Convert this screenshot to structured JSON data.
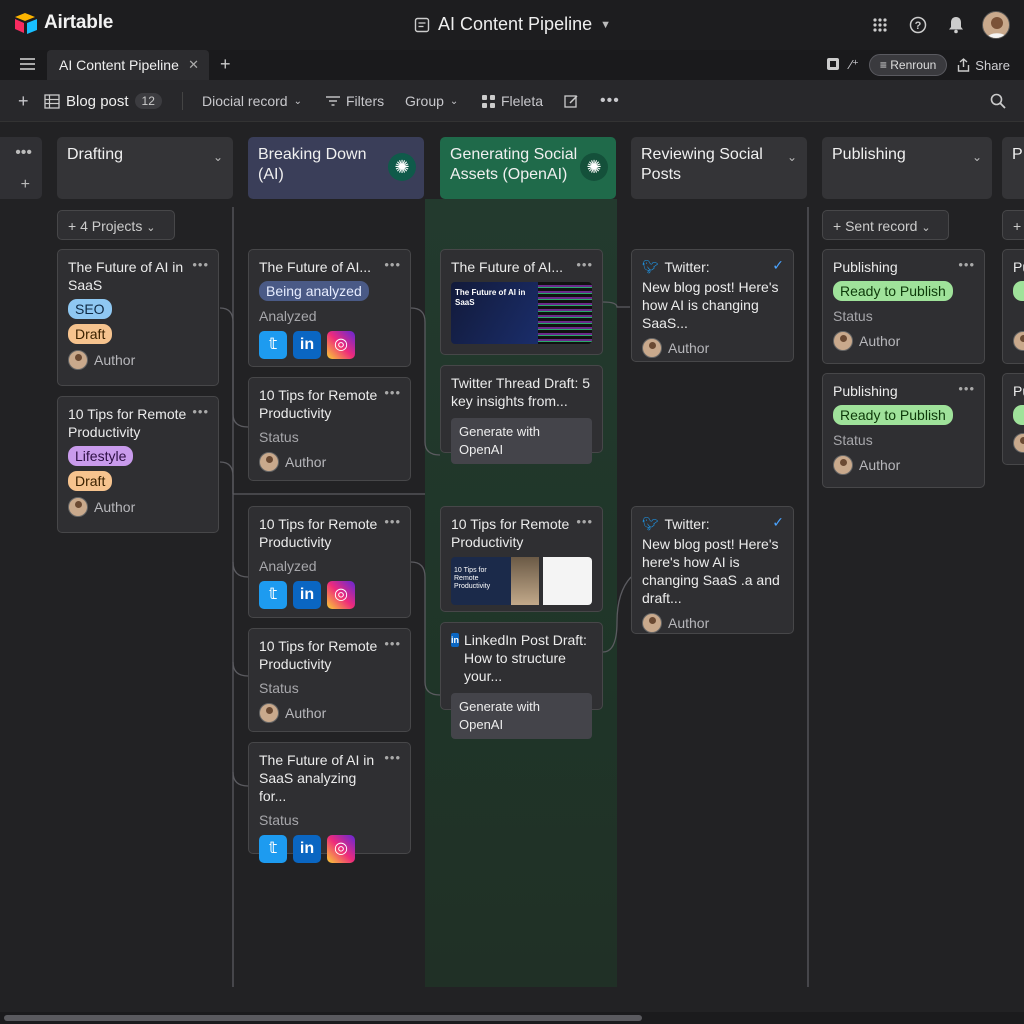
{
  "app": {
    "name": "Airtable",
    "base_title": "AI Content Pipeline"
  },
  "tabbar": {
    "tab_label": "AI Content Pipeline",
    "extensions_label": "Renroun",
    "share_label": "Share"
  },
  "toolbar": {
    "table_name": "Blog post",
    "record_count": "12",
    "view_label": "Diocial record",
    "filters_label": "Filters",
    "group_label": "Group",
    "fields_label": "Fleleta"
  },
  "columns": [
    {
      "title": "Drafting",
      "add_label": "4 Projects"
    },
    {
      "title": "Breaking Down (AI)"
    },
    {
      "title": "Generating Social Assets (OpenAI)"
    },
    {
      "title": "Reviewing Social Posts"
    },
    {
      "title": "Publishing",
      "add_label": "Sent record"
    },
    {
      "title": "P"
    }
  ],
  "drafting": [
    {
      "title": "The Future of AI in SaaS",
      "tag1": "SEO",
      "tag2": "Draft",
      "author": "Author"
    },
    {
      "title": "10 Tips for Remote Productivity",
      "tag1": "Lifestyle",
      "tag2": "Draft",
      "author": "Author"
    }
  ],
  "breaking": [
    {
      "title": "The Future of AI...",
      "tag": "Being analyzed",
      "status": "Analyzed"
    },
    {
      "title": "10 Tips for Remote Productivity",
      "status": "Status",
      "author": "Author"
    },
    {
      "title": "10 Tips for Remote Productivity",
      "status": "Analyzed"
    },
    {
      "title": "10 Tips for Remote Productivity",
      "status": "Status",
      "author": "Author"
    },
    {
      "title": "The Future of AI in SaaS analyzing for...",
      "status": "Status"
    }
  ],
  "generating": [
    {
      "title": "The Future of AI...",
      "thumb_text": "The Future of AI in SaaS"
    },
    {
      "title": "Twitter Thread Draft: 5 key insights from...",
      "button": "Generate with OpenAI"
    },
    {
      "title": "10 Tips for Remote Productivity",
      "thumb_text": "10 Tips for Remote Productivity"
    },
    {
      "title": "LinkedIn Post Draft: How to structure your...",
      "button": "Generate with OpenAI"
    }
  ],
  "reviewing": [
    {
      "platform": "Twitter:",
      "text": "New blog post! Here's how AI is changing SaaS...",
      "author": "Author"
    },
    {
      "platform": "Twitter:",
      "text": "New blog post! Here's here's how AI is changing SaaS .a and draft...",
      "author": "Author"
    }
  ],
  "publishing": [
    {
      "title": "Publishing",
      "tag": "Ready to Publish",
      "status": "Status",
      "author": "Author"
    },
    {
      "title": "Publishing",
      "tag": "Ready to Publish",
      "status": "Status",
      "author": "Author"
    }
  ],
  "partial_col": {
    "card_title": "Pu"
  }
}
